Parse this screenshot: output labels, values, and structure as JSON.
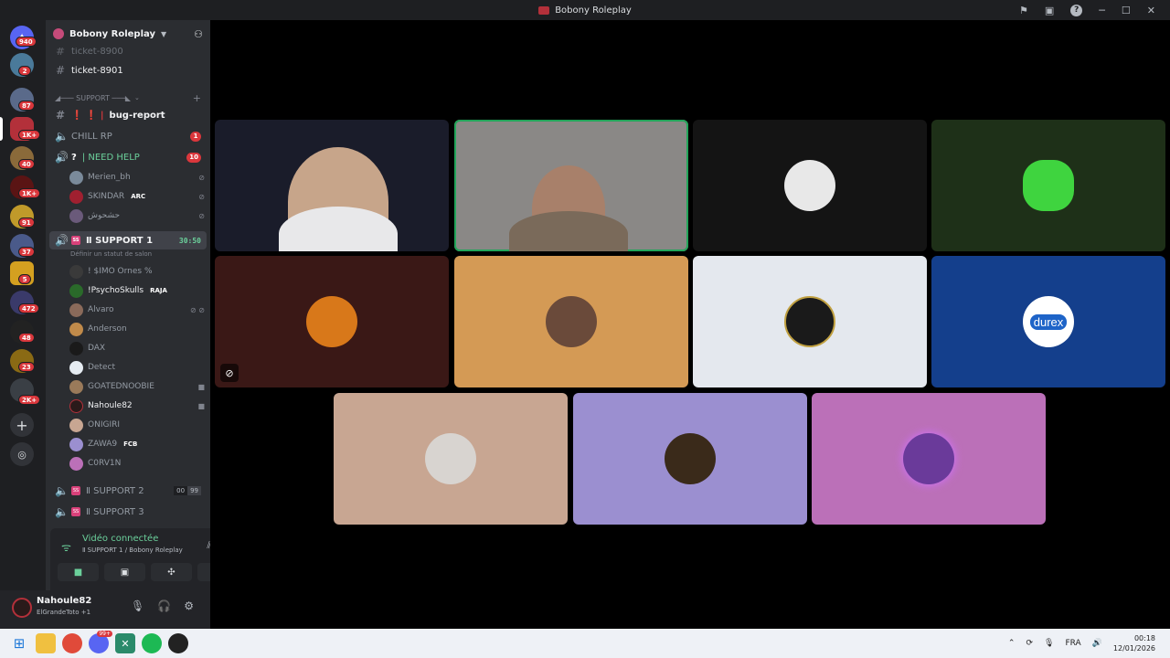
{
  "window": {
    "title": "Bobony Roleplay"
  },
  "rail": {
    "badges": [
      "940",
      "2",
      "87",
      "1K+",
      "40",
      "1K+",
      "91",
      "37",
      "5",
      "472",
      "48",
      "23",
      "2K+"
    ]
  },
  "server": {
    "name": "Bobony Roleplay"
  },
  "channels": {
    "partial_top": "ticket-8900",
    "ticket": "ticket-8901",
    "category": "◢─── SUPPORT ───◣",
    "bug_report": {
      "prefix": "❗ ❗ |",
      "label": "bug-report"
    },
    "chill": {
      "label": "CHILL RP",
      "badge": "1"
    },
    "need_help": {
      "label": "| NEED HELP",
      "badge": "10"
    },
    "need_help_users": [
      {
        "name": "Merien_bh"
      },
      {
        "name": "SKINDAR",
        "tag": "ARC"
      },
      {
        "name": "حشحوش"
      }
    ],
    "support1": {
      "label": "Ⅱ SUPPORT 1",
      "timer": "30:50",
      "status": "Définir un statut de salon"
    },
    "support1_users": [
      {
        "name": "! $IMO Ornes %"
      },
      {
        "name": "!PsychoSkulls",
        "tag": "RAJA"
      },
      {
        "name": "Alvaro"
      },
      {
        "name": "Anderson"
      },
      {
        "name": "DAX"
      },
      {
        "name": "Detect"
      },
      {
        "name": "GOATEDNOOBIE"
      },
      {
        "name": "Nahoule82"
      },
      {
        "name": "ONIGIRI"
      },
      {
        "name": "ZAWA9",
        "tag": "FCB"
      },
      {
        "name": "C0RV1N"
      }
    ],
    "support2": {
      "label": "Ⅱ SUPPORT 2",
      "count_a": "00",
      "count_b": "99"
    },
    "support3": {
      "label": "Ⅱ SUPPORT 3"
    }
  },
  "voice": {
    "status": "Vidéo connectée",
    "route": "Ⅱ SUPPORT 1 / Bobony Roleplay"
  },
  "user": {
    "name": "Nahoule82",
    "status": "ElGrandeToto +1"
  },
  "tiles": [
    {
      "name": "webcam-1",
      "bg": "#1a1c2a"
    },
    {
      "name": "webcam-2",
      "bg": "#8a8886"
    },
    {
      "name": "avatar-3",
      "bg": "#141414"
    },
    {
      "name": "avatar-4",
      "bg": "#1e3018"
    },
    {
      "name": "avatar-5",
      "bg": "#3a1816"
    },
    {
      "name": "avatar-6",
      "bg": "#d49a55"
    },
    {
      "name": "avatar-7",
      "bg": "#e4e8ee"
    },
    {
      "name": "avatar-8",
      "bg": "#143f8c",
      "text": "durex"
    },
    {
      "name": "avatar-9",
      "bg": "#c8a692"
    },
    {
      "name": "avatar-10",
      "bg": "#9b8fd0"
    },
    {
      "name": "avatar-11",
      "bg": "#bb70b8"
    }
  ],
  "taskbar": {
    "lang": "FRA",
    "time": "00:18",
    "date": "12/01/2026",
    "discord_badge": "99+"
  }
}
